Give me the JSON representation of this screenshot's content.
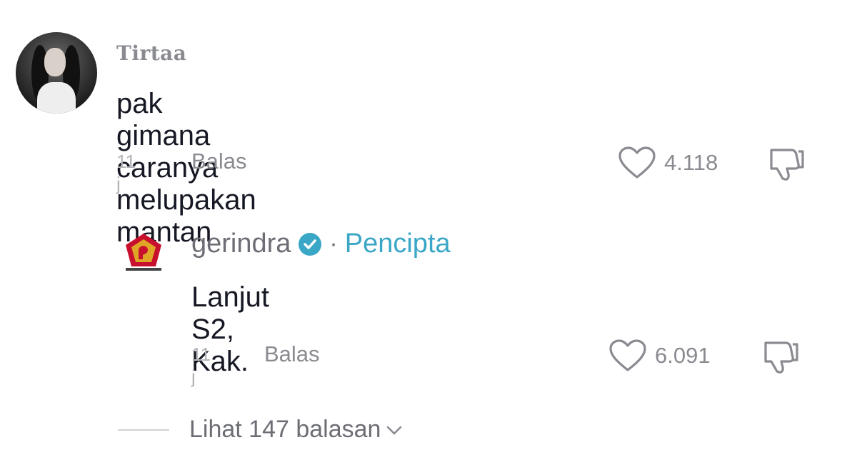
{
  "comment": {
    "username": "Tirtaa",
    "text": "pak gimana caranya melupakan mantan",
    "time": "11 j",
    "reply_label": "Balas",
    "likes": "4.118"
  },
  "reply": {
    "username": "gerindra",
    "separator": "·",
    "creator_badge": "Pencipta",
    "text": "Lanjut S2, Kak.",
    "time": "11 j",
    "reply_label": "Balas",
    "likes": "6.091"
  },
  "view_replies": {
    "label": "Lihat 147 balasan"
  },
  "icons": {
    "like": "heart-outline-icon",
    "dislike": "thumbs-down-icon",
    "verified": "verified-check-icon",
    "chevron": "chevron-down-icon"
  },
  "colors": {
    "verified": "#3aa7c7",
    "creator_badge": "#3aa7c7",
    "logo_red": "#c8102e",
    "logo_gold": "#e0a526"
  }
}
